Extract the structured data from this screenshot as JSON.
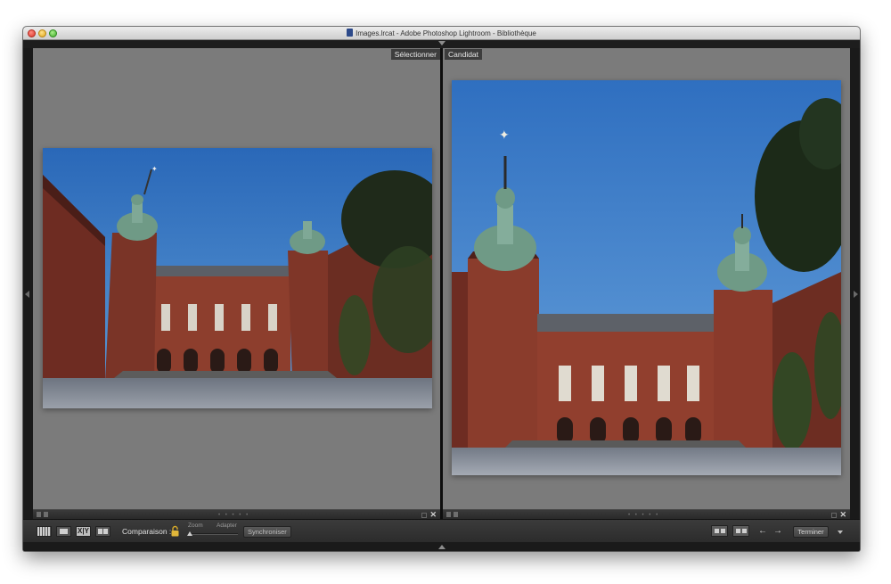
{
  "window": {
    "title": "Images.lrcat - Adobe Photoshop Lightroom - Bibliothèque"
  },
  "left_pane": {
    "label": "Sélectionner",
    "photo_name": "city-hall-photo-wide"
  },
  "right_pane": {
    "label": "Candidat",
    "photo_name": "city-hall-photo-close"
  },
  "pane_footer": {
    "dots": "• • • • •",
    "close": "✕"
  },
  "toolbar": {
    "view_modes": [
      "grid-view-icon",
      "loupe-view-icon",
      "compare-view-icon",
      "survey-view-icon"
    ],
    "compare_mode_text": "X|Y",
    "comparison_label": "Comparaison :",
    "zoom_label": "Zoom",
    "fit_label": "Adapter",
    "sync_label": "Synchroniser",
    "prev_arrow": "←",
    "next_arrow": "→",
    "done_label": "Terminer"
  },
  "colors": {
    "pane_bg": "#7b7b7b",
    "window_bg": "#1a1a1a",
    "sky": "#3a7cc6",
    "brick": "#8b3a2c",
    "roof_copper": "#6f9a86"
  }
}
